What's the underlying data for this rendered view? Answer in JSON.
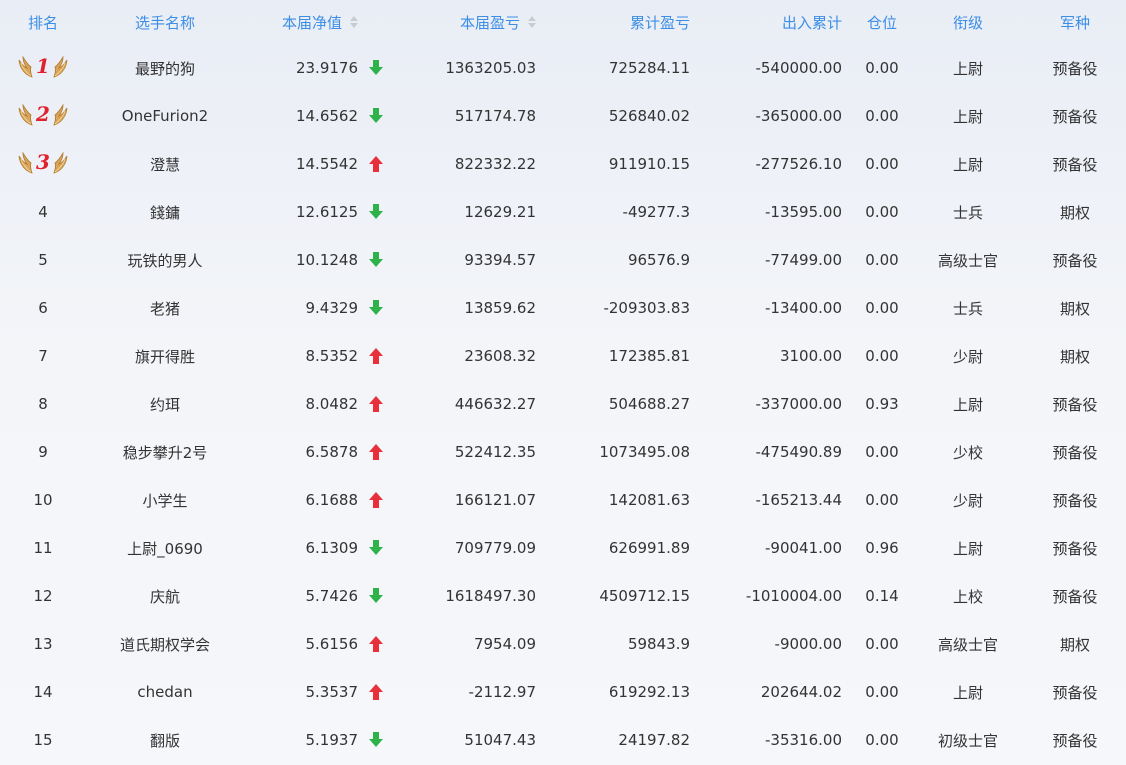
{
  "colors": {
    "header_text": "#3d8ee6",
    "up": "#e8303b",
    "down": "#2db34a",
    "medal_number": "#e0212e"
  },
  "header": {
    "rank": "排名",
    "name": "选手名称",
    "nav": "本届净值",
    "pnl": "本届盈亏",
    "cum_pnl": "累计盈亏",
    "flow": "出入累计",
    "position": "仓位",
    "rank_title": "衔级",
    "branch": "军种"
  },
  "rows": [
    {
      "rank": "1",
      "name": "最野的狗",
      "nav": "23.9176",
      "trend": "down",
      "pnl": "1363205.03",
      "cum_pnl": "725284.11",
      "flow": "-540000.00",
      "position": "0.00",
      "title": "上尉",
      "branch": "预备役"
    },
    {
      "rank": "2",
      "name": "OneFurion2",
      "nav": "14.6562",
      "trend": "down",
      "pnl": "517174.78",
      "cum_pnl": "526840.02",
      "flow": "-365000.00",
      "position": "0.00",
      "title": "上尉",
      "branch": "预备役"
    },
    {
      "rank": "3",
      "name": "澄慧",
      "nav": "14.5542",
      "trend": "up",
      "pnl": "822332.22",
      "cum_pnl": "911910.15",
      "flow": "-277526.10",
      "position": "0.00",
      "title": "上尉",
      "branch": "预备役"
    },
    {
      "rank": "4",
      "name": "錢鏞",
      "nav": "12.6125",
      "trend": "down",
      "pnl": "12629.21",
      "cum_pnl": "-49277.3",
      "flow": "-13595.00",
      "position": "0.00",
      "title": "士兵",
      "branch": "期权"
    },
    {
      "rank": "5",
      "name": "玩铁的男人",
      "nav": "10.1248",
      "trend": "down",
      "pnl": "93394.57",
      "cum_pnl": "96576.9",
      "flow": "-77499.00",
      "position": "0.00",
      "title": "高级士官",
      "branch": "预备役"
    },
    {
      "rank": "6",
      "name": "老猪",
      "nav": "9.4329",
      "trend": "down",
      "pnl": "13859.62",
      "cum_pnl": "-209303.83",
      "flow": "-13400.00",
      "position": "0.00",
      "title": "士兵",
      "branch": "期权"
    },
    {
      "rank": "7",
      "name": "旗开得胜",
      "nav": "8.5352",
      "trend": "up",
      "pnl": "23608.32",
      "cum_pnl": "172385.81",
      "flow": "3100.00",
      "position": "0.00",
      "title": "少尉",
      "branch": "期权"
    },
    {
      "rank": "8",
      "name": "约珥",
      "nav": "8.0482",
      "trend": "up",
      "pnl": "446632.27",
      "cum_pnl": "504688.27",
      "flow": "-337000.00",
      "position": "0.93",
      "title": "上尉",
      "branch": "预备役"
    },
    {
      "rank": "9",
      "name": "稳步攀升2号",
      "nav": "6.5878",
      "trend": "up",
      "pnl": "522412.35",
      "cum_pnl": "1073495.08",
      "flow": "-475490.89",
      "position": "0.00",
      "title": "少校",
      "branch": "预备役"
    },
    {
      "rank": "10",
      "name": "小学生",
      "nav": "6.1688",
      "trend": "up",
      "pnl": "166121.07",
      "cum_pnl": "142081.63",
      "flow": "-165213.44",
      "position": "0.00",
      "title": "少尉",
      "branch": "预备役"
    },
    {
      "rank": "11",
      "name": "上尉_0690",
      "nav": "6.1309",
      "trend": "down",
      "pnl": "709779.09",
      "cum_pnl": "626991.89",
      "flow": "-90041.00",
      "position": "0.96",
      "title": "上尉",
      "branch": "预备役"
    },
    {
      "rank": "12",
      "name": "庆航",
      "nav": "5.7426",
      "trend": "down",
      "pnl": "1618497.30",
      "cum_pnl": "4509712.15",
      "flow": "-1010004.00",
      "position": "0.14",
      "title": "上校",
      "branch": "预备役"
    },
    {
      "rank": "13",
      "name": "道氏期权学会",
      "nav": "5.6156",
      "trend": "up",
      "pnl": "7954.09",
      "cum_pnl": "59843.9",
      "flow": "-9000.00",
      "position": "0.00",
      "title": "高级士官",
      "branch": "期权"
    },
    {
      "rank": "14",
      "name": "chedan",
      "nav": "5.3537",
      "trend": "up",
      "pnl": "-2112.97",
      "cum_pnl": "619292.13",
      "flow": "202644.02",
      "position": "0.00",
      "title": "上尉",
      "branch": "预备役"
    },
    {
      "rank": "15",
      "name": "翻版",
      "nav": "5.1937",
      "trend": "down",
      "pnl": "51047.43",
      "cum_pnl": "24197.82",
      "flow": "-35316.00",
      "position": "0.00",
      "title": "初级士官",
      "branch": "预备役"
    }
  ]
}
